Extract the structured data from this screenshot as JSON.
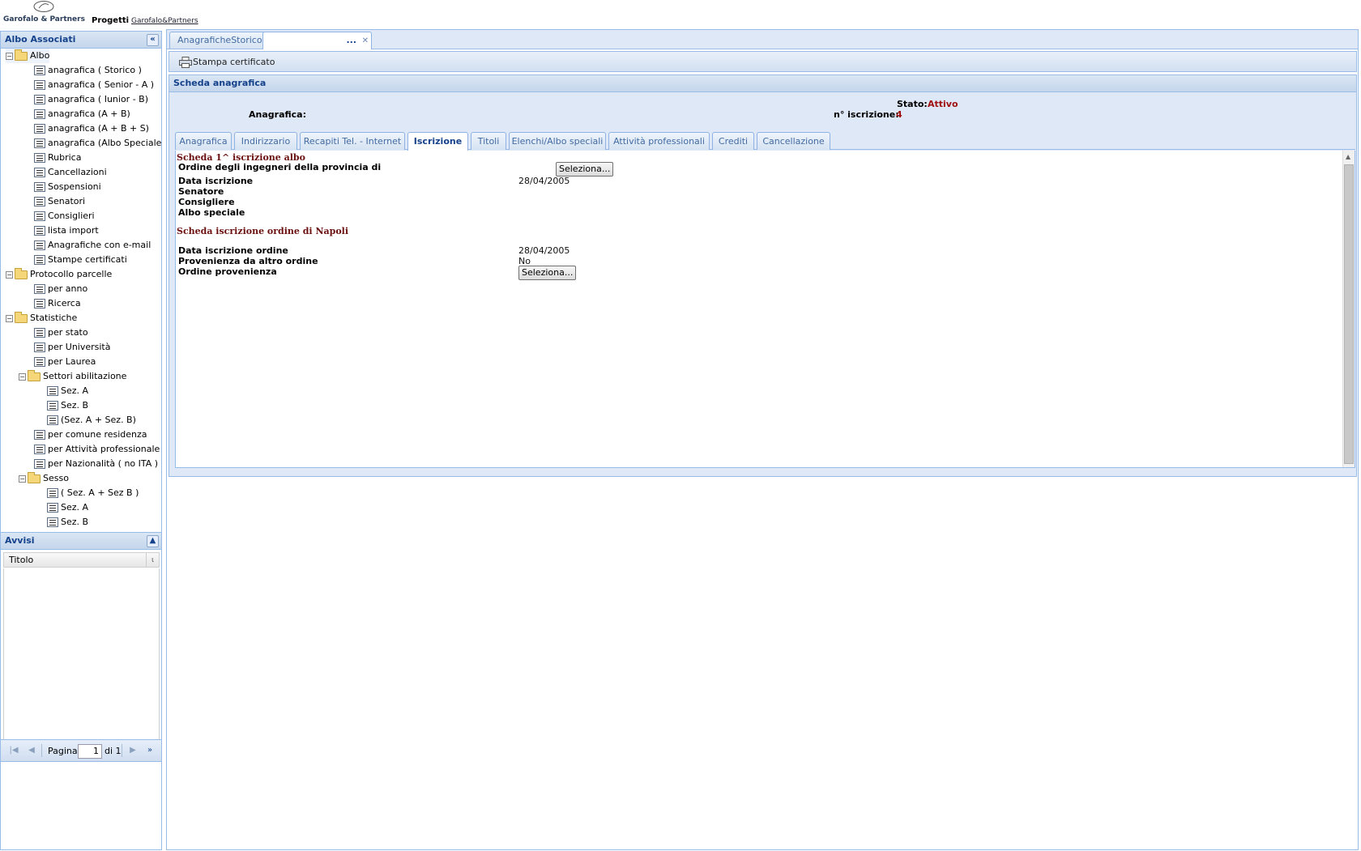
{
  "header": {
    "brand": "Garofalo & Partners",
    "title": "Progetti",
    "link": "Garofalo&Partners"
  },
  "west": {
    "title": "Albo Associati",
    "collapse_icon": "double-chevron-left-icon",
    "tree": [
      {
        "label": "Albo",
        "type": "folder"
      },
      {
        "label": "anagrafica ( Storico )",
        "type": "leaf"
      },
      {
        "label": "anagrafica ( Senior - A )",
        "type": "leaf"
      },
      {
        "label": "anagrafica ( Iunior - B)",
        "type": "leaf"
      },
      {
        "label": "anagrafica (A + B)",
        "type": "leaf"
      },
      {
        "label": "anagrafica (A + B + S)",
        "type": "leaf"
      },
      {
        "label": "anagrafica (Albo Speciale)",
        "type": "leaf"
      },
      {
        "label": "Rubrica",
        "type": "leaf"
      },
      {
        "label": "Cancellazioni",
        "type": "leaf"
      },
      {
        "label": "Sospensioni",
        "type": "leaf"
      },
      {
        "label": "Senatori",
        "type": "leaf"
      },
      {
        "label": "Consiglieri",
        "type": "leaf"
      },
      {
        "label": "lista import",
        "type": "leaf"
      },
      {
        "label": "Anagrafiche con e-mail",
        "type": "leaf"
      },
      {
        "label": "Stampe certificati",
        "type": "leaf"
      },
      {
        "label": "Protocollo parcelle",
        "type": "folder"
      },
      {
        "label": "per anno",
        "type": "leaf"
      },
      {
        "label": "Ricerca",
        "type": "leaf"
      },
      {
        "label": "Statistiche",
        "type": "folder"
      },
      {
        "label": "per stato",
        "type": "leaf"
      },
      {
        "label": "per Università",
        "type": "leaf"
      },
      {
        "label": "per Laurea",
        "type": "leaf"
      },
      {
        "label": "Settori abilitazione",
        "type": "folder"
      },
      {
        "label": "Sez. A",
        "type": "leaf"
      },
      {
        "label": "Sez. B",
        "type": "leaf"
      },
      {
        "label": "(Sez. A + Sez. B)",
        "type": "leaf"
      },
      {
        "label": "per comune residenza",
        "type": "leaf"
      },
      {
        "label": "per Attività professionale",
        "type": "leaf"
      },
      {
        "label": "per Nazionalità ( no ITA )",
        "type": "leaf"
      },
      {
        "label": "Sesso",
        "type": "folder"
      },
      {
        "label": "( Sez. A + Sez B )",
        "type": "leaf"
      },
      {
        "label": "Sez. A",
        "type": "leaf"
      },
      {
        "label": "Sez. B",
        "type": "leaf"
      }
    ],
    "avvisi": {
      "title": "Avvisi",
      "column": "Titolo",
      "pager": {
        "page_label": "Pagina",
        "page": "1",
        "of_label": "di 1"
      }
    }
  },
  "center": {
    "tabs": [
      "AnagraficheStorico",
      "..."
    ],
    "toolbar": {
      "print_label": "Stampa certificato"
    },
    "scheda": {
      "title": "Scheda anagrafica",
      "anagrafica_label": "Anagrafica:",
      "stato_label": "Stato:",
      "stato_value": "Attivo",
      "iscrizione_label": "n° iscrizione:",
      "iscrizione_value": "4"
    },
    "inner_tabs": [
      "Anagrafica",
      "Indirizzario",
      "Recapiti Tel. - Internet",
      "Iscrizione",
      "Titoli",
      "Elenchi/Albo speciali",
      "Attività professionali",
      "Crediti",
      "Cancellazione"
    ],
    "active_inner_tab": "Iscrizione",
    "form": {
      "sec1_title": "Scheda 1^ iscrizione albo",
      "ordine_label": "Ordine degli ingegneri della  provincia di",
      "select_button": "Seleziona...",
      "data_iscrizione_label": "Data iscrizione",
      "data_iscrizione_value": "28/04/2005",
      "senatore_label": "Senatore",
      "consigliere_label": "Consigliere",
      "albo_speciale_label": "Albo speciale",
      "sec2_title": "Scheda iscrizione ordine di Napoli",
      "data_iscrizione_ordine_label": "Data iscrizione ordine",
      "data_iscrizione_ordine_value": "28/04/2005",
      "provenienza_label": "Provenienza da altro ordine",
      "provenienza_value": "No",
      "ordine_provenienza_label": "Ordine provenienza",
      "select_button_2": "Seleziona..."
    }
  }
}
